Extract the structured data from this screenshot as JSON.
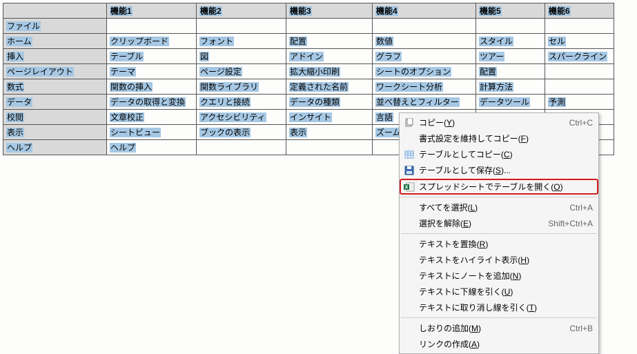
{
  "table": {
    "headers": [
      "",
      "機能1",
      "機能2",
      "機能3",
      "機能4",
      "機能5",
      "機能6"
    ],
    "rows": [
      {
        "h": "ファイル",
        "c": [
          "",
          "",
          "",
          "",
          "",
          ""
        ]
      },
      {
        "h": "ホーム",
        "c": [
          "クリップボード",
          "フォント",
          "配置",
          "数値",
          "スタイル",
          "セル"
        ]
      },
      {
        "h": "挿入",
        "c": [
          "テーブル",
          "図",
          "アドイン",
          "グラフ",
          "ツアー",
          "スパークライン"
        ]
      },
      {
        "h": "ページレイアウト",
        "c": [
          "テーマ",
          "ページ設定",
          "拡大縮小印刷",
          "シートのオプション",
          "配置",
          ""
        ]
      },
      {
        "h": "数式",
        "c": [
          "関数の挿入",
          "関数ライブラリ",
          "定義された名前",
          "ワークシート分析",
          "計算方法",
          ""
        ]
      },
      {
        "h": "データ",
        "c": [
          "データの取得と変換",
          "クエリと接続",
          "データの種類",
          "並べ替えとフィルター",
          "データツール",
          "予測"
        ]
      },
      {
        "h": "校閲",
        "c": [
          "文章校正",
          "アクセシビリティ",
          "インサイト",
          "言語",
          "",
          ""
        ]
      },
      {
        "h": "表示",
        "c": [
          "シートビュー",
          "ブックの表示",
          "表示",
          "ズーム",
          "",
          ""
        ]
      },
      {
        "h": "ヘルプ",
        "c": [
          "ヘルプ",
          "",
          "",
          "",
          "",
          ""
        ]
      }
    ]
  },
  "menu": {
    "copy": "コピー(Y)",
    "copy_sc": "Ctrl+C",
    "copy_fmt": "書式設定を維持してコピー(F)",
    "copy_tbl": "テーブルとしてコピー(C)",
    "save_tbl": "テーブルとして保存(S)...",
    "open_ss": "スプレッドシートでテーブルを開く(O)",
    "select_all": "すべてを選択(L)",
    "select_all_sc": "Ctrl+A",
    "deselect": "選択を解除(E)",
    "deselect_sc": "Shift+Ctrl+A",
    "replace": "テキストを置換(R)",
    "highlight": "テキストをハイライト表示(H)",
    "note": "テキストにノートを追加(N)",
    "underline": "テキストに下線を引く(U)",
    "strike": "テキストに取り消し線を引く(T)",
    "bookmark": "しおりの追加(M)",
    "bookmark_sc": "Ctrl+B",
    "link": "リンクの作成(A)"
  }
}
